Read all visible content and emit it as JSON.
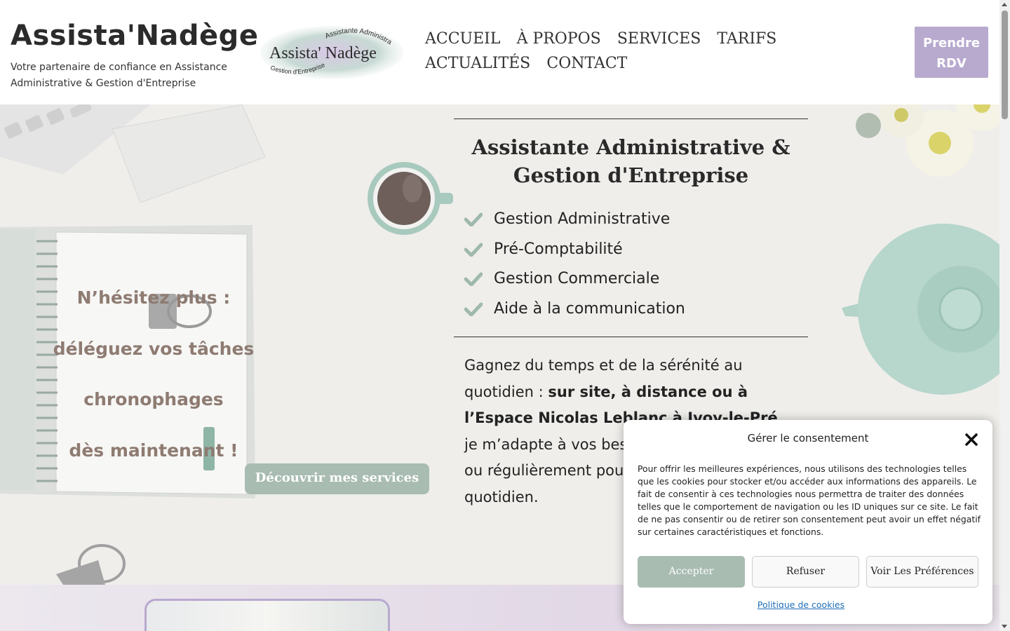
{
  "header": {
    "site_title": "Assista'Nadège",
    "tagline": "Votre partenaire de confiance en Assistance Administrative & Gestion d'Entreprise",
    "logo": {
      "main": "Assista' Nadège",
      "top_arc": "Assistante Administrative",
      "bottom_arc": "Gestion d'Entreprise"
    },
    "nav": [
      "ACCUEIL",
      "À PROPOS",
      "SERVICES",
      "TARIFS",
      "ACTUALITÉS",
      "CONTACT"
    ],
    "cta_label": "Prendre RDV"
  },
  "hero": {
    "left_lines": [
      "N’hésitez plus :",
      "déléguez vos tâches",
      "chronophages",
      "dès maintenant !"
    ],
    "discover_button": "Découvrir mes services",
    "panel_title": "Assistante Administrative & Gestion d'Entreprise",
    "services": [
      "Gestion Administrative",
      "Pré-Comptabilité",
      "Gestion Commerciale",
      "Aide à la communication"
    ],
    "intro_start": "Gagnez du temps et de la sérénité au quotidien : ",
    "intro_bold": "sur site, à distance ou à l’Espace Nicolas Leblanc à Ivoy-le-Pré",
    "intro_end": ", je m’adapte à vos besoins ponctuellement ou régulièrement pour alléger votre quotidien."
  },
  "consent": {
    "title": "Gérer le consentement",
    "text": "Pour offrir les meilleures expériences, nous utilisons des technologies telles que les cookies pour stocker et/ou accéder aux informations des appareils. Le fait de consentir à ces technologies nous permettra de traiter des données telles que le comportement de navigation ou les ID uniques sur ce site. Le fait de ne pas consentir ou de retirer son consentement peut avoir un effet négatif sur certaines caractéristiques et fonctions.",
    "accept": "Accepter",
    "refuse": "Refuser",
    "preferences": "Voir Les Préférences",
    "policy_link": "Politique de cookies"
  },
  "colors": {
    "accent_lavender": "#b8a9cf",
    "accent_sage": "#a8bcb2",
    "hero_text_taupe": "#8e7b72",
    "hero_bg": "#efeeeb",
    "link_blue": "#1e6fb8"
  },
  "icons": [
    "check-icon",
    "close-icon",
    "scroll-up-arrow-icon",
    "scroll-down-arrow-icon"
  ]
}
